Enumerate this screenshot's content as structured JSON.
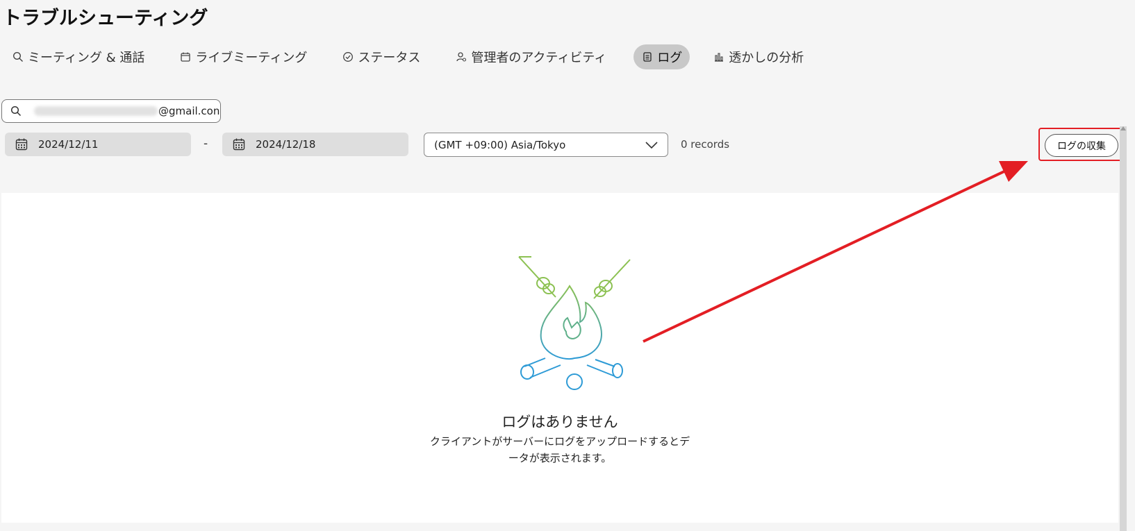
{
  "page": {
    "title": "トラブルシューティング"
  },
  "tabs": [
    {
      "label": "ミーティング & 通話",
      "icon": "search-icon"
    },
    {
      "label": "ライブミーティング",
      "icon": "calendar-icon"
    },
    {
      "label": "ステータス",
      "icon": "check-circle-icon"
    },
    {
      "label": "管理者のアクティビティ",
      "icon": "admin-user-icon"
    },
    {
      "label": "ログ",
      "icon": "document-icon",
      "active": true
    },
    {
      "label": "透かしの分析",
      "icon": "bar-chart-icon"
    }
  ],
  "search": {
    "value_suffix": "@gmail.con"
  },
  "date_range": {
    "start": "2024/12/11",
    "separator": "-",
    "end": "2024/12/18"
  },
  "timezone": {
    "selected": "(GMT +09:00) Asia/Tokyo"
  },
  "records": {
    "label": "0 records"
  },
  "collect_button": {
    "label": "ログの収集"
  },
  "empty_state": {
    "title": "ログはありません",
    "description_line1": "クライアントがサーバーにログをアップロードするとデ",
    "description_line2": "ータが表示されます。"
  },
  "annotation": {
    "color": "#e31e24"
  },
  "colors": {
    "active_tab_bg": "#c8c8c8",
    "illustration_green": "#8cc152",
    "illustration_blue": "#2e9bd6"
  }
}
